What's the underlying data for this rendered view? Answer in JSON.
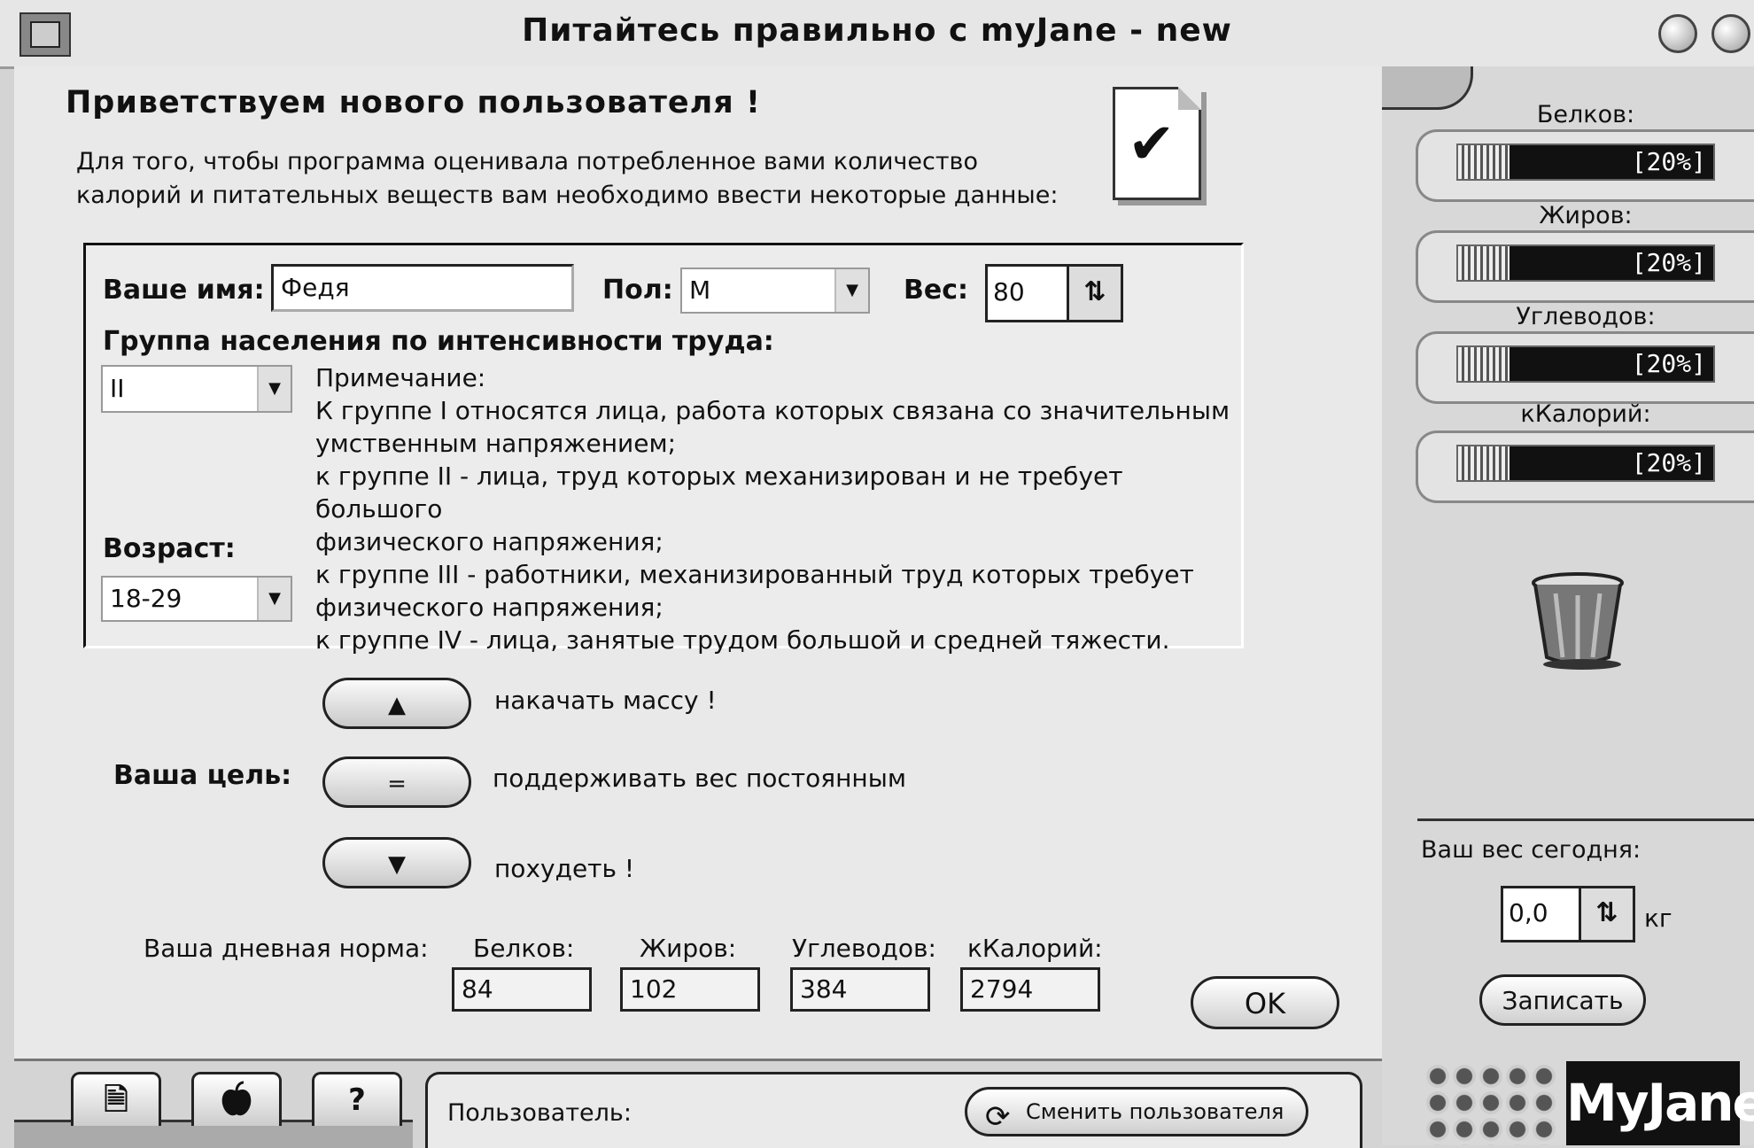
{
  "window": {
    "title": "Питайтесь правильно с myJane - new"
  },
  "heading": "Приветствуем нового пользователя !",
  "intro_lines": [
    "Для того, чтобы программа оценивала потребленное вами количество",
    "калорий и питательных веществ вам необходимо ввести некоторые данные:"
  ],
  "form": {
    "name_label": "Ваше имя:",
    "name_value": "Федя",
    "sex_label": "Пол:",
    "sex_value": "М",
    "weight_label": "Вес:",
    "weight_value": "80",
    "group_label": "Группа населения по интенсивности труда:",
    "group_value": "II",
    "age_label": "Возраст:",
    "age_value": "18-29",
    "note_lines": [
      "Примечание:",
      "К группе I относятся лица, работа которых связана со значительным",
      "умственным напряжением;",
      "к группе II - лица, труд которых механизирован и не требует большого",
      "физического напряжения;",
      "к группе III - работники, механизированный труд которых требует",
      "физического напряжения;",
      "к группе IV - лица, занятые трудом большой и средней тяжести."
    ]
  },
  "goal": {
    "label": "Ваша цель:",
    "options": [
      {
        "symbol": "▲",
        "text": "накачать массу !"
      },
      {
        "symbol": "=",
        "text": "поддерживать вес постоянным"
      },
      {
        "symbol": "▼",
        "text": "похудеть !"
      }
    ]
  },
  "norm": {
    "label": "Ваша дневная норма:",
    "items": [
      {
        "label": "Белков:",
        "value": "84"
      },
      {
        "label": "Жиров:",
        "value": "102"
      },
      {
        "label": "Углеводов:",
        "value": "384"
      },
      {
        "label": "кКалорий:",
        "value": "2794"
      }
    ]
  },
  "ok_label": "OK",
  "sidebar": {
    "meters": [
      {
        "label": "Белков:",
        "text": "[20%]",
        "level": 0.2
      },
      {
        "label": "Жиров:",
        "text": "[20%]",
        "level": 0.2
      },
      {
        "label": "Углеводов:",
        "text": "[20%]",
        "level": 0.2
      },
      {
        "label": "кКалорий:",
        "text": "[20%]",
        "level": 0.2
      }
    ],
    "weight_today_label": "Ваш вес сегодня:",
    "weight_today_value": "0,0",
    "weight_unit": "кг",
    "record_label": "Записать",
    "logo_text": "MyJane"
  },
  "bottom": {
    "tabs": [
      {
        "icon": "document-icon",
        "glyph": "🗎"
      },
      {
        "icon": "apple-icon",
        "glyph": ""
      },
      {
        "icon": "help-icon",
        "glyph": "?"
      }
    ],
    "user_label": "Пользователь:",
    "switch_user_label": "Сменить пользователя"
  }
}
